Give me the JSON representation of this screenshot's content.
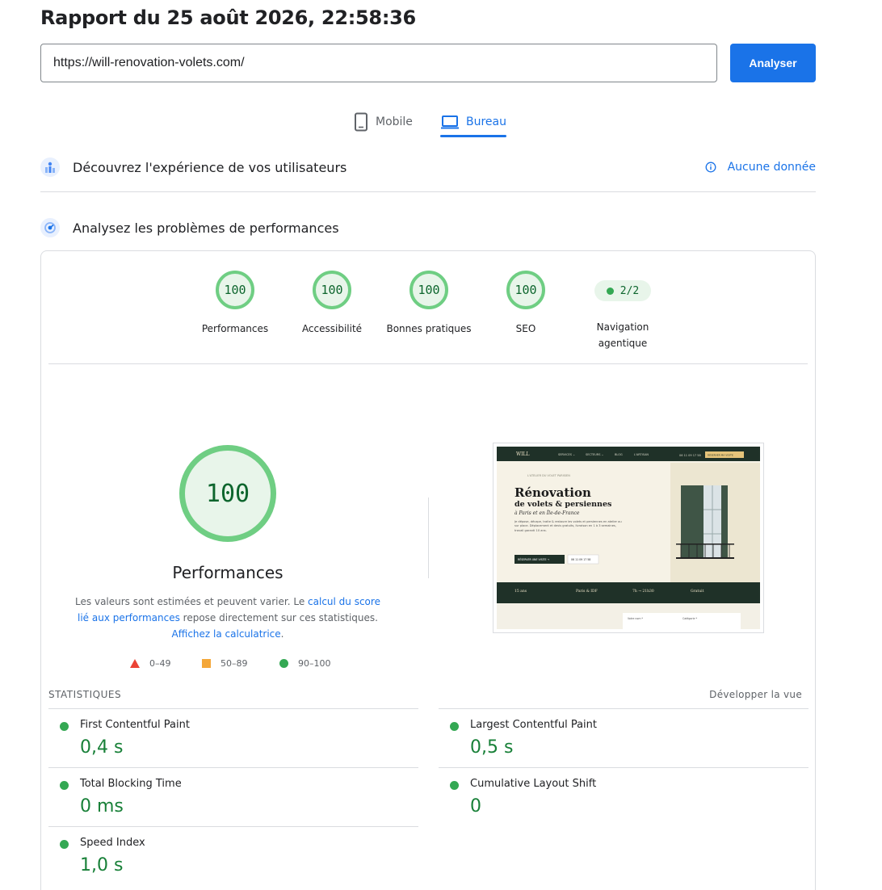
{
  "report": {
    "title": "Rapport du 25 août 2026, 22:58:36"
  },
  "search": {
    "url": "https://will-renovation-volets.com/",
    "analyze_label": "Analyser"
  },
  "tabs": [
    {
      "label": "Mobile"
    },
    {
      "label": "Bureau"
    }
  ],
  "sections": {
    "user_experience": {
      "title": "Découvrez l'expérience de vos utilisateurs",
      "no_data": "Aucune donnée"
    },
    "performance": {
      "title": "Analysez les problèmes de performances"
    }
  },
  "scores": [
    {
      "value": "100",
      "label": "Performances"
    },
    {
      "value": "100",
      "label": "Accessibilité"
    },
    {
      "value": "100",
      "label": "Bonnes pratiques"
    },
    {
      "value": "100",
      "label": "SEO"
    },
    {
      "value": "2/2",
      "label": "Navigation agentique"
    }
  ],
  "main_gauge": {
    "value": "100",
    "title": "Performances",
    "desc_1": "Les valeurs sont estimées et peuvent varier. Le ",
    "link_1": "calcul du score lié aux performances",
    "desc_2": " repose directement sur ces statistiques. ",
    "link_2": "Affichez la calculatrice",
    "desc_3": "."
  },
  "legend": [
    {
      "range": "0–49"
    },
    {
      "range": "50–89"
    },
    {
      "range": "90–100"
    }
  ],
  "preview": {
    "logo": "WILL",
    "nav": [
      "SERVICES ⌄",
      "SECTEURS ⌄",
      "BLOG",
      "L'ARTISAN"
    ],
    "phone": "06 11 09 17 58",
    "cta": "RÉSERVER MA VISITE",
    "eyebrow": "L'ATELIER DU VOLET PARISIEN",
    "h1": "Rénovation",
    "h2": "de volets & persiennes",
    "h3": "à Paris et en Île-de-France",
    "para": "Je dépose, décape, traite & restaure les volets et persiennes en atelier ou sur place. Déplacement et devis gratuits, livraison en 1 à 3 semaines, travail garanti 10 ans.",
    "btn1": "RÉSERVER UNE VISITE →",
    "btn2": "06 11 09 17 58",
    "stats": [
      "15 ans",
      "Paris & IDF",
      "7h → 21h30",
      "Gratuit"
    ],
    "form1": "Votre nom *",
    "form2": "Catégorie *"
  },
  "stats": {
    "heading": "STATISTIQUES",
    "expand": "Développer la vue",
    "metrics": [
      {
        "label": "First Contentful Paint",
        "value": "0,4 s"
      },
      {
        "label": "Largest Contentful Paint",
        "value": "0,5 s"
      },
      {
        "label": "Total Blocking Time",
        "value": "0 ms"
      },
      {
        "label": "Cumulative Layout Shift",
        "value": "0"
      },
      {
        "label": "Speed Index",
        "value": "1,0 s"
      }
    ]
  },
  "colors": {
    "accent": "#1a73e8",
    "pass": "#34a853",
    "average": "#f4a739",
    "fail": "#eb4335"
  }
}
